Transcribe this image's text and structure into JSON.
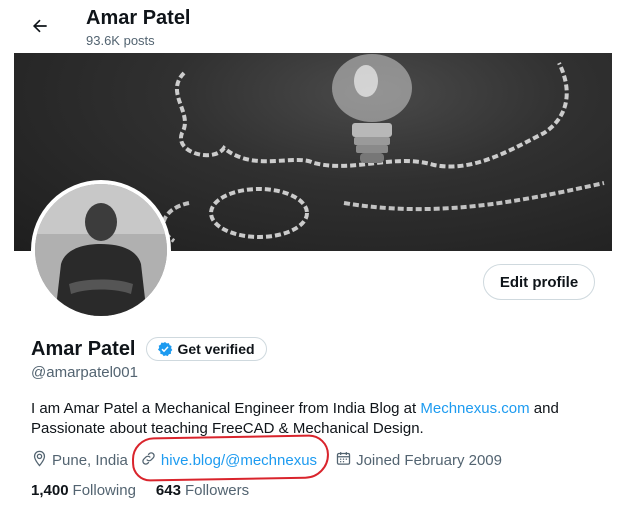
{
  "header": {
    "back_icon": "arrow-left-icon",
    "title": "Amar Patel",
    "subtitle": "93.6K posts"
  },
  "banner": {
    "icon": "lightbulb-chalkboard-image"
  },
  "profile": {
    "avatar_icon": "avatar-photo",
    "edit_button": "Edit profile",
    "name": "Amar Patel",
    "verify_button": "Get verified",
    "handle": "@amarpatel001",
    "bio_prefix": "I am Amar Patel a Mechanical Engineer from India Blog at ",
    "bio_link": "Mechnexus.com",
    "bio_suffix": " and Passionate about teaching FreeCAD & Mechanical Design.",
    "location": "Pune, India",
    "website": "hive.blog/@mechnexus",
    "joined": "Joined February 2009",
    "following_count": "1,400",
    "following_label": "Following",
    "followers_count": "643",
    "followers_label": "Followers"
  },
  "colors": {
    "accent": "#1d9bf0",
    "secondary_text": "#536471",
    "annotation": "#d9242c"
  }
}
